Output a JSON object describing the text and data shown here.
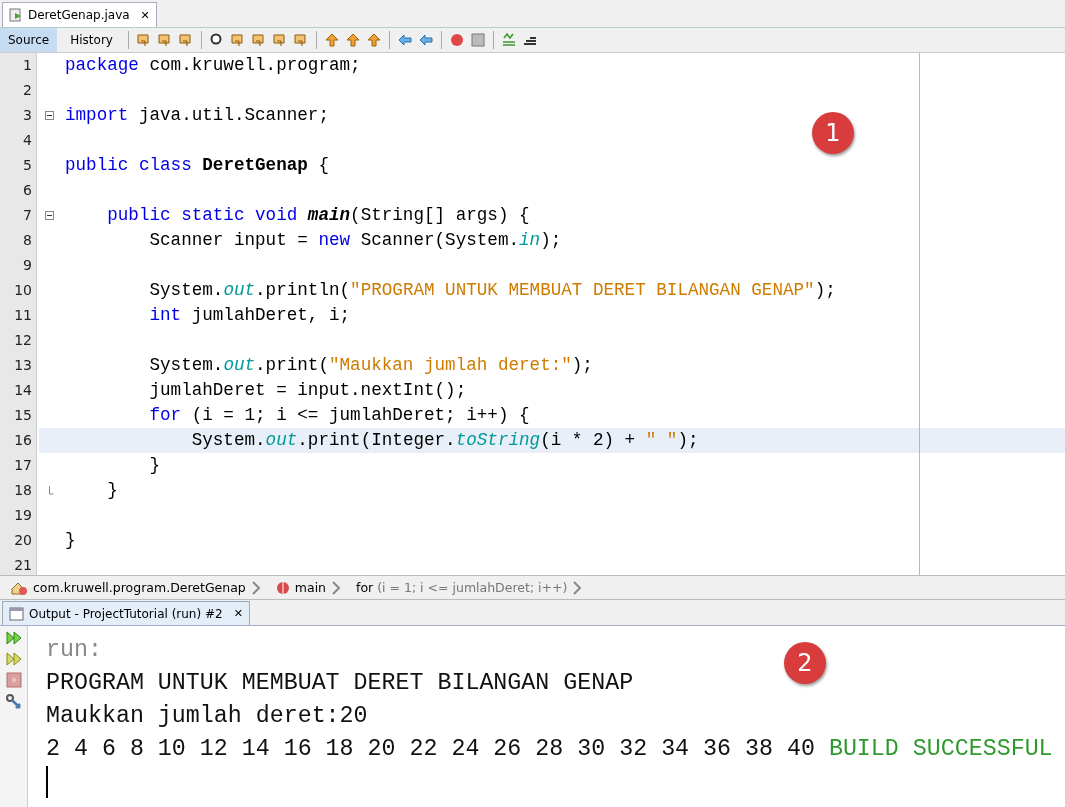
{
  "file_tab": {
    "label": "DeretGenap.java",
    "close": "✕"
  },
  "view_tabs": [
    {
      "label": "Source",
      "selected": true
    },
    {
      "label": "History",
      "selected": false
    }
  ],
  "editor": {
    "lines": [
      {
        "number": "1",
        "tokens": [
          {
            "kind": "keyword",
            "text": "package"
          },
          {
            "kind": "plain",
            "text": " com.kruwell.program;"
          }
        ]
      },
      {
        "number": "2"
      },
      {
        "number": "3",
        "fold": true,
        "tokens": [
          {
            "kind": "keyword",
            "text": "import"
          },
          {
            "kind": "plain",
            "text": " java.util.Scanner;"
          }
        ]
      },
      {
        "number": "4"
      },
      {
        "number": "5",
        "tokens": [
          {
            "kind": "keyword",
            "text": "public class "
          },
          {
            "kind": "bold",
            "text": "DeretGenap"
          },
          {
            "kind": "plain",
            "text": " {"
          }
        ]
      },
      {
        "number": "6"
      },
      {
        "number": "7",
        "fold": true,
        "tokens": [
          {
            "kind": "keyword",
            "text": "    public static void "
          },
          {
            "kind": "bolditalic",
            "text": "main"
          },
          {
            "kind": "plain",
            "text": "(String[] args) {"
          }
        ]
      },
      {
        "number": "8",
        "tokens": [
          {
            "kind": "plain",
            "text": "        Scanner input = "
          },
          {
            "kind": "keyword",
            "text": "new"
          },
          {
            "kind": "plain",
            "text": " Scanner(System."
          },
          {
            "kind": "field",
            "text": "in"
          },
          {
            "kind": "plain",
            "text": ");"
          }
        ]
      },
      {
        "number": "9"
      },
      {
        "number": "10",
        "tokens": [
          {
            "kind": "plain",
            "text": "        System."
          },
          {
            "kind": "field",
            "text": "out"
          },
          {
            "kind": "plain",
            "text": ".println("
          },
          {
            "kind": "string",
            "text": "\"PROGRAM UNTUK MEMBUAT DERET BILANGAN GENAP\""
          },
          {
            "kind": "plain",
            "text": ");"
          }
        ]
      },
      {
        "number": "11",
        "tokens": [
          {
            "kind": "keyword",
            "text": "        int"
          },
          {
            "kind": "plain",
            "text": " jumlahDeret, i;"
          }
        ]
      },
      {
        "number": "12"
      },
      {
        "number": "13",
        "tokens": [
          {
            "kind": "plain",
            "text": "        System."
          },
          {
            "kind": "field",
            "text": "out"
          },
          {
            "kind": "plain",
            "text": ".print("
          },
          {
            "kind": "string",
            "text": "\"Maukkan jumlah deret:\""
          },
          {
            "kind": "plain",
            "text": ");"
          }
        ]
      },
      {
        "number": "14",
        "tokens": [
          {
            "kind": "plain",
            "text": "        jumlahDeret = input.nextInt();"
          }
        ]
      },
      {
        "number": "15",
        "tokens": [
          {
            "kind": "keyword",
            "text": "        for"
          },
          {
            "kind": "plain",
            "text": " (i = 1; i <= jumlahDeret; i++) {"
          }
        ]
      },
      {
        "number": "16",
        "current": true,
        "tokens": [
          {
            "kind": "plain",
            "text": "            System."
          },
          {
            "kind": "field",
            "text": "out"
          },
          {
            "kind": "plain",
            "text": ".print(Integer."
          },
          {
            "kind": "field",
            "text": "toString"
          },
          {
            "kind": "plain",
            "text": "(i * 2) + "
          },
          {
            "kind": "string",
            "text": "\" \""
          },
          {
            "kind": "plain",
            "text": ");"
          }
        ]
      },
      {
        "number": "17",
        "tokens": [
          {
            "kind": "plain",
            "text": "        }"
          }
        ]
      },
      {
        "number": "18",
        "fold_end": true,
        "tokens": [
          {
            "kind": "plain",
            "text": "    }"
          }
        ]
      },
      {
        "number": "19"
      },
      {
        "number": "20",
        "tokens": [
          {
            "kind": "plain",
            "text": "}"
          }
        ]
      },
      {
        "number": "21"
      }
    ]
  },
  "breadcrumb": [
    {
      "text": "com.kruwell.program.DeretGenap"
    },
    {
      "text": "main"
    },
    {
      "text": "for",
      "detail": " (i = 1; i <= jumlahDeret; i++)"
    }
  ],
  "output_tab": {
    "label": "Output - ProjectTutorial (run) #2",
    "close": "✕"
  },
  "output": {
    "lines": [
      {
        "segments": [
          {
            "kind": "muted",
            "text": "run:"
          }
        ]
      },
      {
        "segments": [
          {
            "kind": "plain",
            "text": "PROGRAM UNTUK MEMBUAT DERET BILANGAN GENAP"
          }
        ]
      },
      {
        "segments": [
          {
            "kind": "plain",
            "text": "Maukkan jumlah deret:20"
          }
        ]
      },
      {
        "segments": [
          {
            "kind": "plain",
            "text": "2 4 6 8 10 12 14 16 18 20 22 24 26 28 30 32 34 36 38 40 "
          },
          {
            "kind": "success",
            "text": "BUILD SUCCESSFUL"
          }
        ]
      }
    ]
  },
  "callouts": [
    "1",
    "2"
  ]
}
